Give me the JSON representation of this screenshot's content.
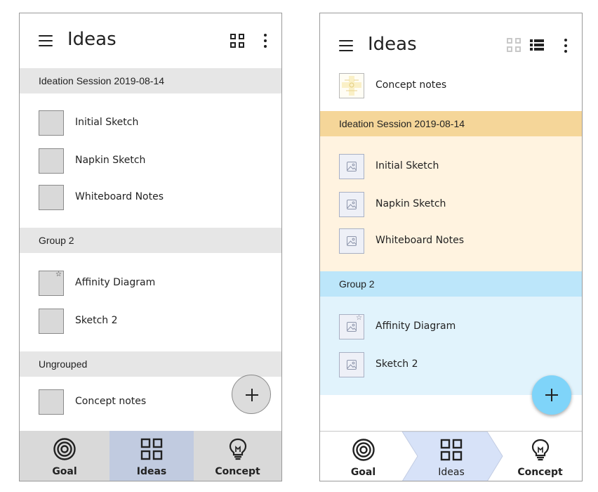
{
  "colors": {
    "phone_a_section_bg": "#e6e6e6",
    "phone_a_nav_bg": "#d9d9d9",
    "phone_a_nav_active_bg": "#c1cbe0",
    "phone_a_fab_bg": "#dcdcdc",
    "phone_b_section1_header_bg": "#f5d699",
    "phone_b_section1_body_bg": "#fff3e0",
    "phone_b_section2_header_bg": "#bce6fa",
    "phone_b_section2_body_bg": "#e1f3fc",
    "phone_b_nav_active_bg": "#d7e2f8",
    "phone_b_fab_bg": "#7fd4f9"
  },
  "phone_a": {
    "title": "Ideas",
    "toolbar_icons": [
      "menu-icon",
      "grid-view-icon",
      "more-vert-icon"
    ],
    "sections": [
      {
        "header": "Ideation Session 2019-08-14",
        "items": [
          {
            "label": "Initial Sketch",
            "starred": false
          },
          {
            "label": "Napkin Sketch",
            "starred": false
          },
          {
            "label": "Whiteboard Notes",
            "starred": false
          }
        ]
      },
      {
        "header": "Group 2",
        "items": [
          {
            "label": "Affinity Diagram",
            "starred": true
          },
          {
            "label": "Sketch 2",
            "starred": false
          }
        ]
      },
      {
        "header": "Ungrouped",
        "items": [
          {
            "label": "Concept notes",
            "starred": false
          }
        ]
      }
    ],
    "fab_icon": "plus-icon",
    "nav": [
      {
        "label": "Goal",
        "icon": "target-icon",
        "active": false
      },
      {
        "label": "Ideas",
        "icon": "grid-icon",
        "active": true
      },
      {
        "label": "Concept",
        "icon": "lightbulb-icon",
        "active": false
      }
    ]
  },
  "phone_b": {
    "title": "Ideas",
    "toolbar_icons": [
      "menu-icon",
      "grid-view-icon",
      "list-view-icon",
      "more-vert-icon"
    ],
    "top_item": {
      "label": "Concept notes",
      "thumb": "concept-thumbnail"
    },
    "sections": [
      {
        "header": "Ideation Session 2019-08-14",
        "items": [
          {
            "label": "Initial Sketch",
            "starred": false
          },
          {
            "label": "Napkin Sketch",
            "starred": false
          },
          {
            "label": "Whiteboard Notes",
            "starred": false
          }
        ]
      },
      {
        "header": "Group 2",
        "items": [
          {
            "label": "Affinity Diagram",
            "starred": true
          },
          {
            "label": "Sketch 2",
            "starred": false
          }
        ]
      }
    ],
    "fab_icon": "plus-icon",
    "nav": [
      {
        "label": "Goal",
        "icon": "target-icon",
        "active": false
      },
      {
        "label": "Ideas",
        "icon": "grid-icon",
        "active": true
      },
      {
        "label": "Concept",
        "icon": "lightbulb-icon",
        "active": false
      }
    ]
  }
}
